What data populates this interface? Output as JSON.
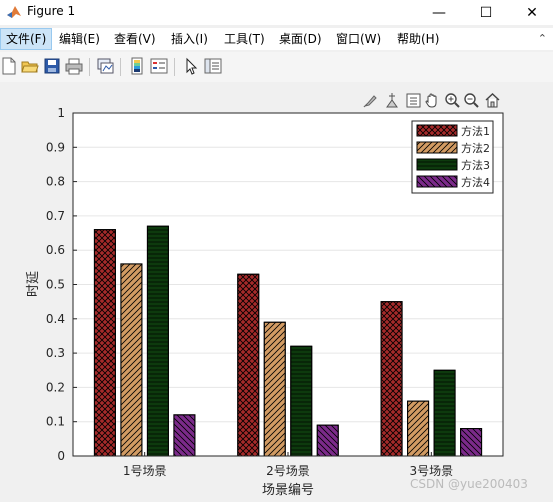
{
  "window": {
    "title": "Figure 1"
  },
  "window_controls": {
    "minimize": "—",
    "maximize": "☐",
    "close": "✕"
  },
  "menu": {
    "items": [
      {
        "label": "文件(F)"
      },
      {
        "label": "编辑(E)"
      },
      {
        "label": "查看(V)"
      },
      {
        "label": "插入(I)"
      },
      {
        "label": "工具(T)"
      },
      {
        "label": "桌面(D)"
      },
      {
        "label": "窗口(W)"
      },
      {
        "label": "帮助(H)"
      }
    ],
    "collapse_arrow": "⌃"
  },
  "toolbar": {
    "icons": [
      "new-figure-icon",
      "open-file-icon",
      "save-icon",
      "print-icon",
      "link-plot-icon",
      "colorbar-icon",
      "legend-icon",
      "select-arrow-icon",
      "property-inspector-icon"
    ]
  },
  "axes_toolbar": {
    "icons": [
      "brush-icon",
      "data-tips-icon",
      "export-icon",
      "pan-icon",
      "zoom-in-icon",
      "zoom-out-icon",
      "home-icon"
    ]
  },
  "chart_data": {
    "type": "bar",
    "categories": [
      "1号场景",
      "2号场景",
      "3号场景"
    ],
    "xlabel": "场景编号",
    "ylabel": "时延",
    "ylim": [
      0,
      1
    ],
    "yticks": [
      "0",
      "0.1",
      "0.2",
      "0.3",
      "0.4",
      "0.5",
      "0.6",
      "0.7",
      "0.8",
      "0.9",
      "1"
    ],
    "grid": "horizontal",
    "legend_position": "top-right",
    "series": [
      {
        "name": "方法1",
        "values": [
          0.66,
          0.53,
          0.45
        ],
        "color": "#a52a2a",
        "hatch": "crosshatch"
      },
      {
        "name": "方法2",
        "values": [
          0.56,
          0.39,
          0.16
        ],
        "color": "#d29b63",
        "hatch": "diagonal"
      },
      {
        "name": "方法3",
        "values": [
          0.67,
          0.32,
          0.25
        ],
        "color": "#0d3a0d",
        "hatch": "horizontal"
      },
      {
        "name": "方法4",
        "values": [
          0.12,
          0.09,
          0.08
        ],
        "color": "#7b2a8a",
        "hatch": "backdiagonal"
      }
    ]
  },
  "watermark": "CSDN @yue200403"
}
